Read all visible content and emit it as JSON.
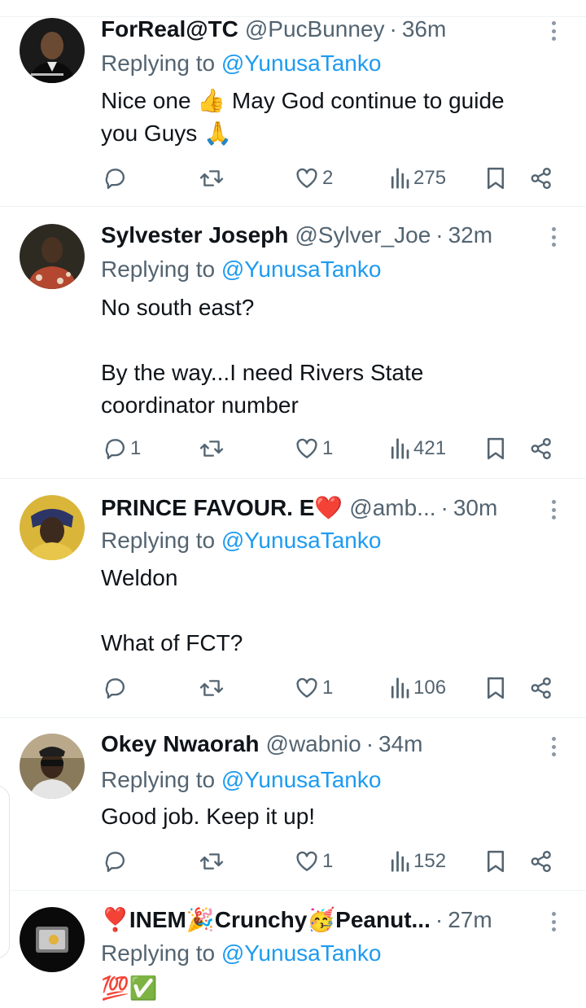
{
  "tweets": [
    {
      "name": "ForReal@TC",
      "handle": "@PucBunney",
      "time": "36m",
      "replying_prefix": "Replying to",
      "replying_to": "@YunusaTanko",
      "body_lines": [
        "Nice one 👍 May God continue to guide",
        "you Guys 🙏"
      ],
      "replies": "",
      "likes": "2",
      "views": "275"
    },
    {
      "name": "Sylvester Joseph",
      "handle": "@Sylver_Joe",
      "time": "32m",
      "replying_prefix": "Replying to",
      "replying_to": "@YunusaTanko",
      "body_lines": [
        "No south east?",
        "",
        "By the way...I need Rivers State",
        "coordinator number"
      ],
      "replies": "1",
      "likes": "1",
      "views": "421"
    },
    {
      "name": "PRINCE FAVOUR. E❤️",
      "handle": "@amb...",
      "time": "30m",
      "replying_prefix": "Replying to",
      "replying_to": "@YunusaTanko",
      "body_lines": [
        "Weldon",
        "",
        "What of FCT?"
      ],
      "replies": "",
      "likes": "1",
      "views": "106"
    },
    {
      "name": "Okey Nwaorah",
      "handle": "@wabnio",
      "time": "34m",
      "replying_prefix": "Replying to",
      "replying_to": "@YunusaTanko",
      "body_lines": [
        "Good job. Keep it up!"
      ],
      "replies": "",
      "likes": "1",
      "views": "152"
    },
    {
      "name": "❣️INEM🎉Crunchy🥳Peanut...",
      "handle": "",
      "time": "27m",
      "replying_prefix": "Replying to",
      "replying_to": "@YunusaTanko",
      "body_lines": [
        "💯✅"
      ],
      "replies": "",
      "likes": "",
      "views": ""
    }
  ],
  "dot_separator": "·",
  "colors": {
    "text": "#0f1419",
    "secondary": "#536471",
    "link": "#1d9bf0",
    "divider": "#eff3f4"
  },
  "icons": {
    "reply": "reply-icon",
    "retweet": "retweet-icon",
    "like": "heart-icon",
    "views": "views-bar-chart-icon",
    "bookmark": "bookmark-icon",
    "share": "share-icon",
    "more": "more-vertical-icon"
  }
}
